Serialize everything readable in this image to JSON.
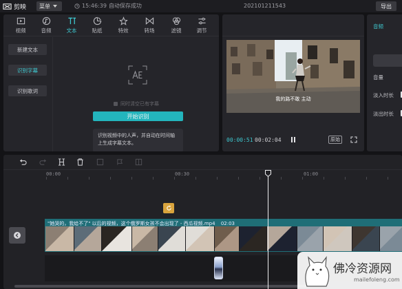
{
  "app": {
    "name": "剪映",
    "menu_label": "菜单",
    "save_time": "15:46:39",
    "save_status": "自动保存成功",
    "project_name": "202101211543",
    "export_label": "导出"
  },
  "media": {
    "tabs": [
      {
        "label": "视频",
        "icon": "video-icon"
      },
      {
        "label": "音频",
        "icon": "audio-icon"
      },
      {
        "label": "文本",
        "icon": "text-icon"
      },
      {
        "label": "贴纸",
        "icon": "sticker-icon"
      },
      {
        "label": "特效",
        "icon": "effects-icon"
      },
      {
        "label": "转场",
        "icon": "transition-icon"
      },
      {
        "label": "滤镜",
        "icon": "filter-icon"
      },
      {
        "label": "调节",
        "icon": "adjust-icon"
      }
    ],
    "active_tab": "文本",
    "side_items": [
      "新建文本",
      "识别字幕",
      "识别歌词"
    ],
    "active_side_item": "识别字幕",
    "sync_option": "同时清空已有字幕",
    "start_button": "开始识别",
    "description": "识别视频中的人声，并自动在时间轴上生成字幕文本。"
  },
  "player": {
    "subtitle": "我的路不敢 主动",
    "current_time": "00:00:51",
    "total_time": "00:02:04",
    "ratio_label": "原始"
  },
  "properties": {
    "tab_label": "音频",
    "volume_label": "音量",
    "fade_in_label": "淡入时长",
    "fade_out_label": "淡出时长"
  },
  "timeline": {
    "ruler_labels": [
      "00:00",
      "00:30",
      "01:00"
    ],
    "clip_title": "\"她哭的，我给不了\" 以后的视频，这个俄罗斯女孩不会出现了 - 西瓜视频.mp4",
    "clip_duration": "02:03"
  },
  "watermark": {
    "text": "佛冷资源网",
    "url": "mailefoleng.com"
  },
  "colors": {
    "accent": "#3ec7cf",
    "button": "#23b5bd",
    "track": "#1f6e77",
    "panel": "#25252a",
    "background": "#131316"
  }
}
